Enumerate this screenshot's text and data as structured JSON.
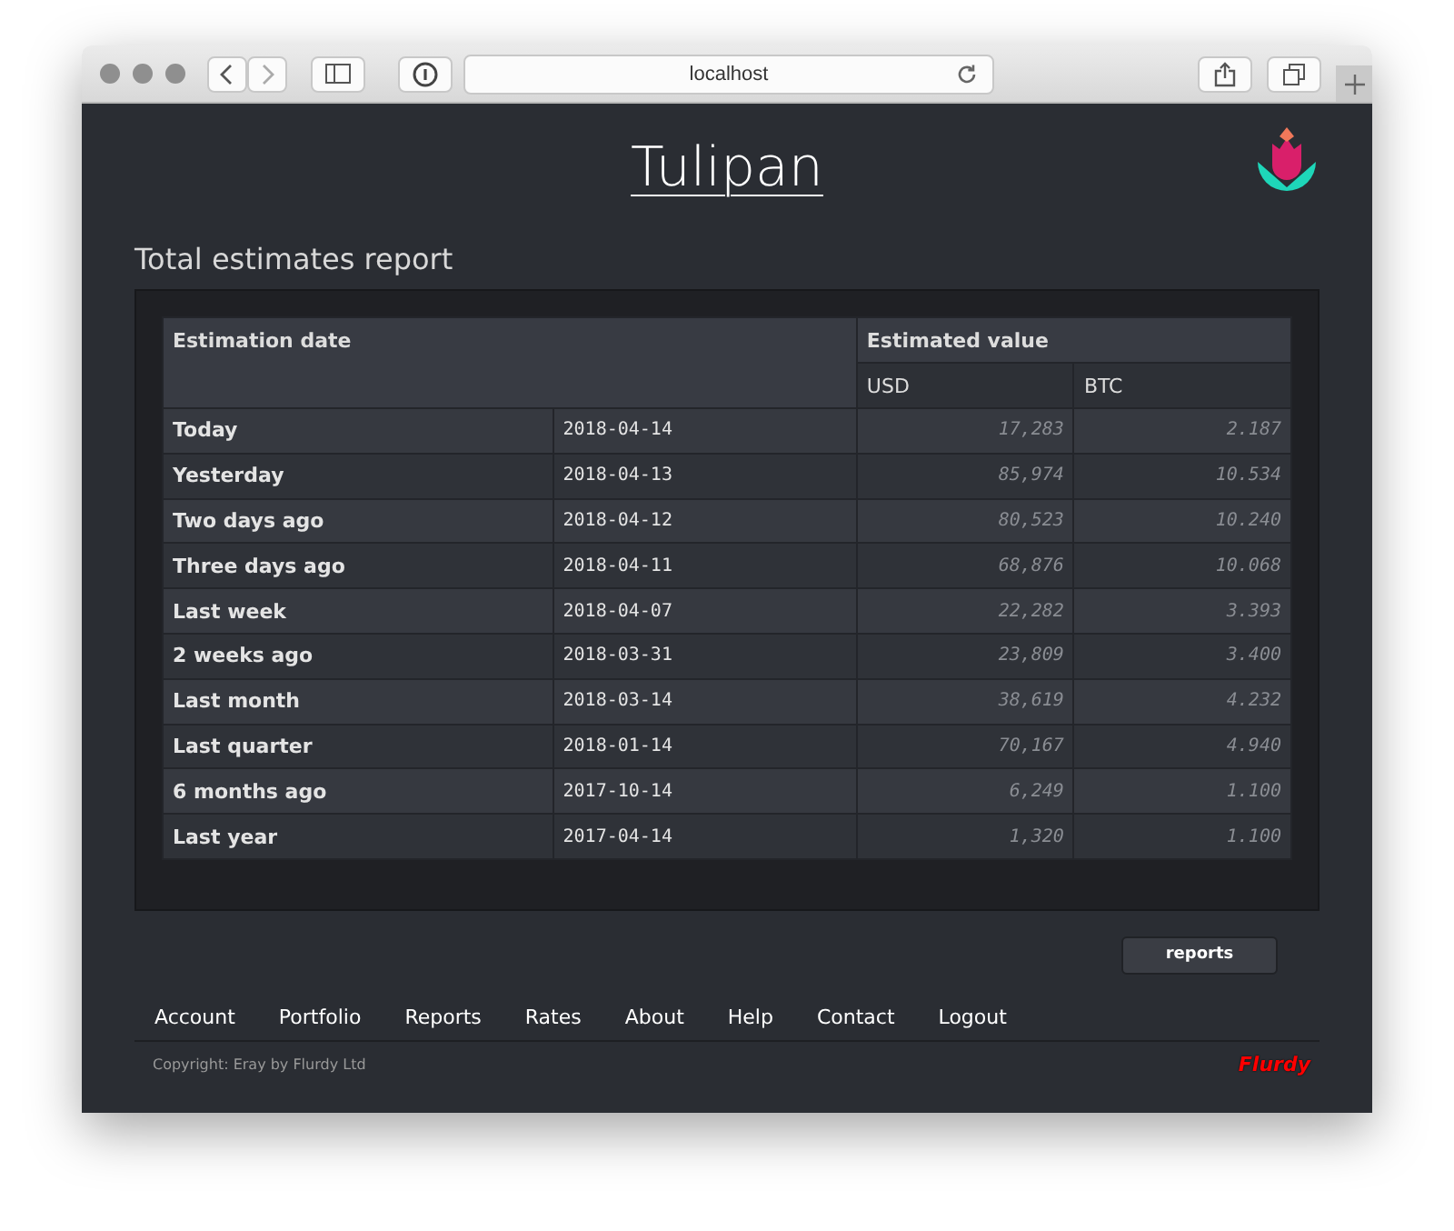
{
  "browser": {
    "url": "localhost"
  },
  "site": {
    "title": "Tulipan"
  },
  "heading": "Total estimates report",
  "table": {
    "header": {
      "date": "Estimation date",
      "value": "Estimated value",
      "currencies": [
        "USD",
        "BTC"
      ]
    },
    "rows": [
      {
        "label": "Today",
        "date": "2018-04-14",
        "usd": "17,283",
        "btc": "2.187"
      },
      {
        "label": "Yesterday",
        "date": "2018-04-13",
        "usd": "85,974",
        "btc": "10.534"
      },
      {
        "label": "Two days ago",
        "date": "2018-04-12",
        "usd": "80,523",
        "btc": "10.240"
      },
      {
        "label": "Three days ago",
        "date": "2018-04-11",
        "usd": "68,876",
        "btc": "10.068"
      },
      {
        "label": "Last week",
        "date": "2018-04-07",
        "usd": "22,282",
        "btc": "3.393"
      },
      {
        "label": "2 weeks ago",
        "date": "2018-03-31",
        "usd": "23,809",
        "btc": "3.400"
      },
      {
        "label": "Last month",
        "date": "2018-03-14",
        "usd": "38,619",
        "btc": "4.232"
      },
      {
        "label": "Last quarter",
        "date": "2018-01-14",
        "usd": "70,167",
        "btc": "4.940"
      },
      {
        "label": "6 months ago",
        "date": "2017-10-14",
        "usd": "6,249",
        "btc": "1.100"
      },
      {
        "label": "Last year",
        "date": "2017-04-14",
        "usd": "1,320",
        "btc": "1.100"
      }
    ]
  },
  "button": "reports",
  "nav": [
    "Account",
    "Portfolio",
    "Reports",
    "Rates",
    "About",
    "Help",
    "Contact",
    "Logout"
  ],
  "footer": {
    "copyright": "Copyright: Eray by Flurdy Ltd",
    "brand": "Flurdy"
  }
}
